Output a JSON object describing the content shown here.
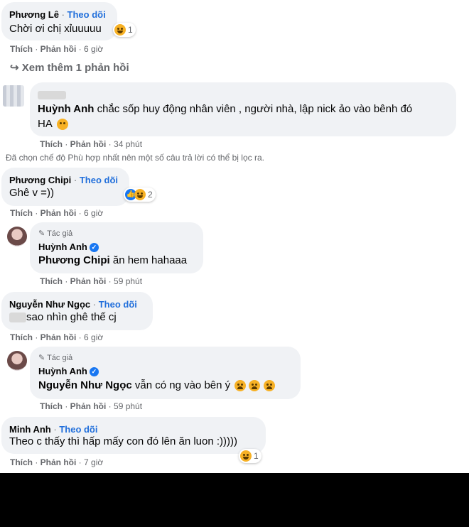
{
  "comments": [
    {
      "name": "Phương Lê",
      "follow": "Theo dõi",
      "text": "Chời ơi chị xỉuuuuu",
      "reaction_count": "1",
      "like": "Thích",
      "reply": "Phản hồi",
      "time": "6 giờ"
    },
    {
      "name": "Phương Chipi",
      "follow": "Theo dõi",
      "text": "Ghê v =))",
      "reaction_count": "2",
      "like": "Thích",
      "reply": "Phản hồi",
      "time": "6 giờ"
    },
    {
      "name": "Nguyễn Như Ngọc",
      "follow": "Theo dõi",
      "text": "sao nhìn ghê thế cj",
      "like": "Thích",
      "reply": "Phản hồi",
      "time": "6 giờ"
    },
    {
      "name": "Minh Anh",
      "follow": "Theo dõi",
      "text": "Theo c thấy thì hấp mấy con đó lên ăn luon :)))))",
      "reaction_count": "1",
      "like": "Thích",
      "reply": "Phản hồi",
      "time": "7 giờ"
    }
  ],
  "more_replies": "Xem thêm 1 phản hồi",
  "reply1": {
    "mention": "Huỳnh Anh",
    "text_line1": "chắc sốp huy động nhân viên , người nhà, lập nick ảo vào bênh đó",
    "text_line2": "HA",
    "like": "Thích",
    "reply": "Phản hồi",
    "time": "34 phút"
  },
  "filter_notice": "Đã chọn chế độ Phù hợp nhất nên một số câu trả lời có thể bị lọc ra.",
  "author_replies": [
    {
      "author_tag": "Tác giả",
      "name": "Huỳnh Anh",
      "mention": "Phương Chipi",
      "text": "ăn hem hahaaa",
      "like": "Thích",
      "reply": "Phản hồi",
      "time": "59 phút"
    },
    {
      "author_tag": "Tác giả",
      "name": "Huỳnh Anh",
      "mention": "Nguyễn Như Ngọc",
      "text": "vẫn có ng vào bên ý",
      "like": "Thích",
      "reply": "Phản hồi",
      "time": "59 phút"
    }
  ],
  "colors": {
    "bubble": "#f0f2f5",
    "link": "#216fdb",
    "meta": "#65676b",
    "verified": "#1877f2"
  }
}
